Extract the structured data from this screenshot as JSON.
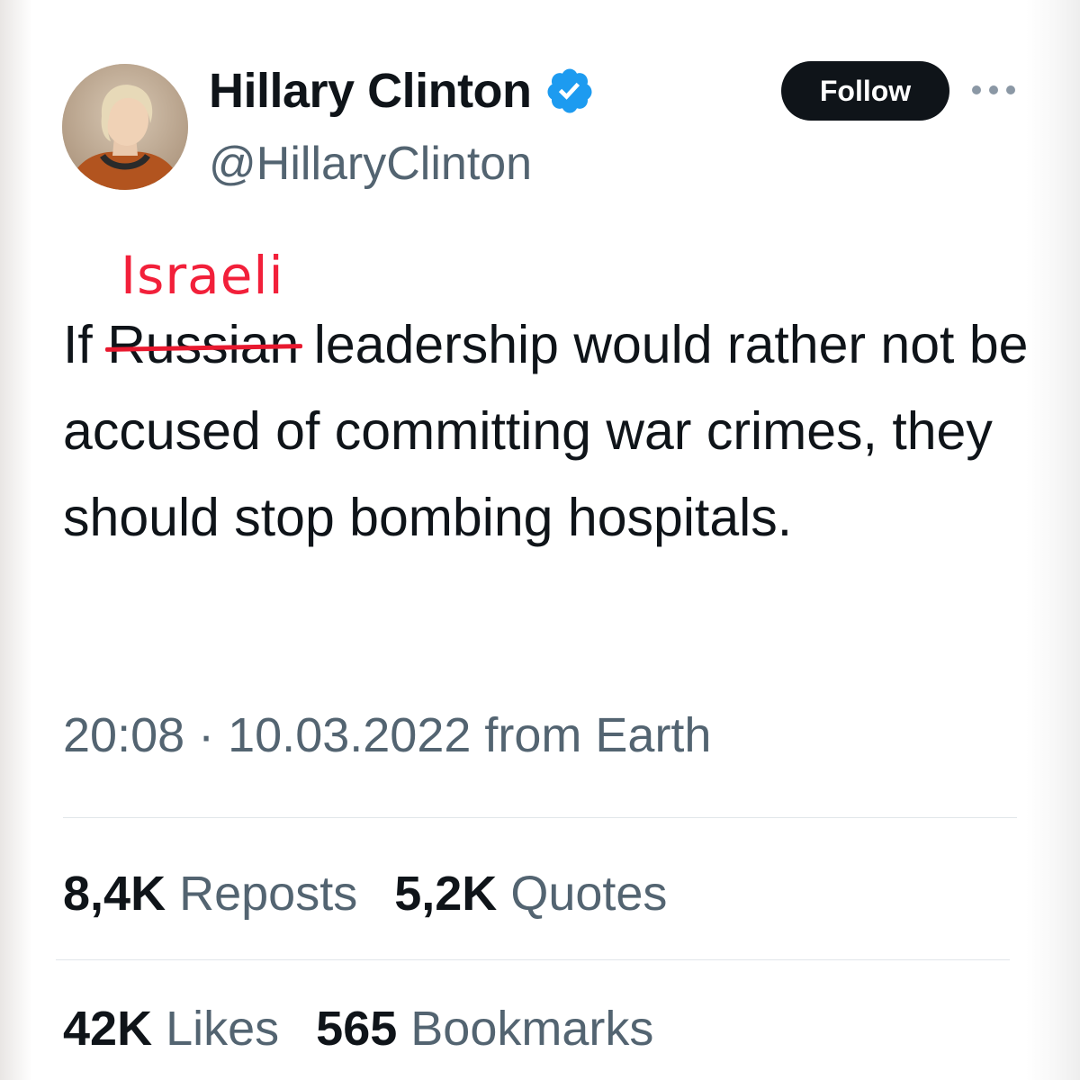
{
  "author": {
    "display_name": "Hillary Clinton",
    "handle": "@HillaryClinton",
    "verified_icon": "verified-badge-icon",
    "verified_color": "#1d9bf0"
  },
  "actions": {
    "follow_label": "Follow",
    "more_icon": "more-options-icon"
  },
  "annotation": {
    "inserted_word": "Israeli",
    "color": "#f2203a"
  },
  "tweet": {
    "text_before": "If ",
    "struck_word": "Russian",
    "text_after": " leadership would rather not be accused of committing war crimes, they should stop bombing hospitals."
  },
  "meta": {
    "timestamp": "20:08 · 10.03.2022 from Earth"
  },
  "stats": {
    "reposts_count": "8,4K",
    "reposts_label": "Reposts",
    "quotes_count": "5,2K",
    "quotes_label": "Quotes",
    "likes_count": "42K",
    "likes_label": "Likes",
    "bookmarks_count": "565",
    "bookmarks_label": "Bookmarks"
  },
  "colors": {
    "text_primary": "#0f1419",
    "text_secondary": "#536471",
    "button_bg": "#0f1419",
    "divider": "#e1e6ea"
  }
}
